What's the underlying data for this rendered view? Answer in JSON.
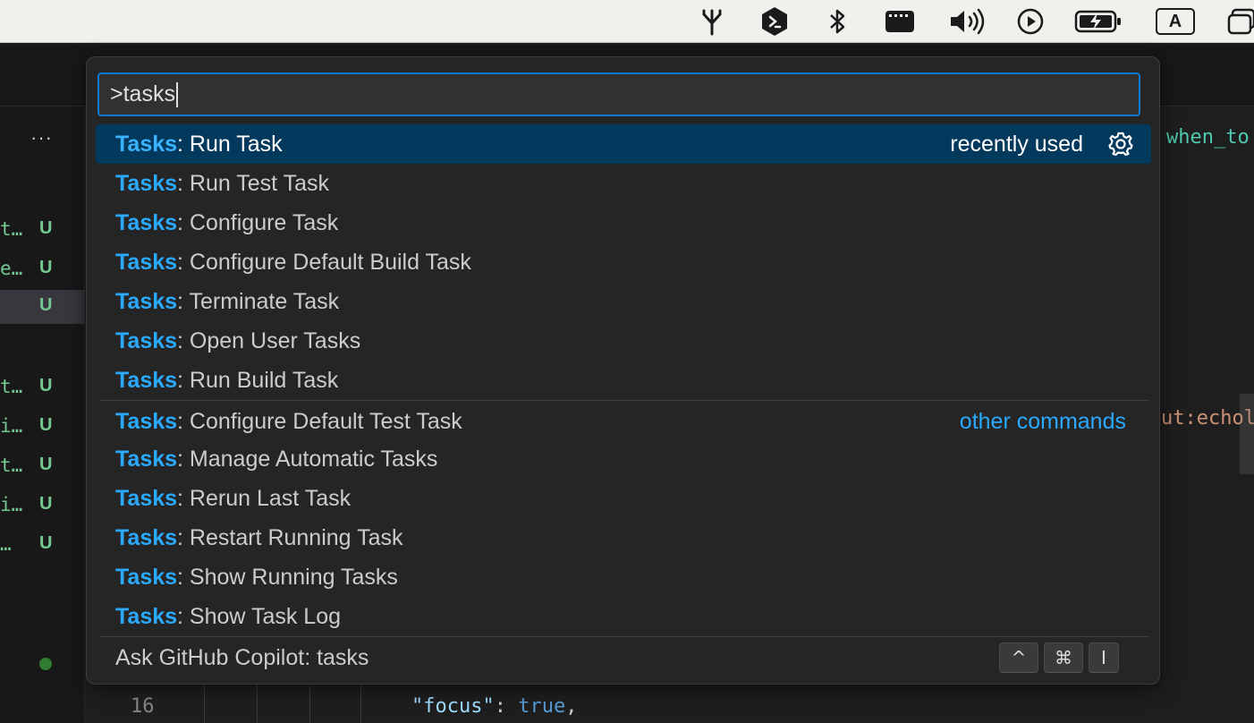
{
  "menubar": {
    "icons": [
      "fork-icon",
      "terminal-shield-icon",
      "bluetooth-icon",
      "display-icon",
      "volume-icon",
      "play-circle-icon",
      "battery-charging-icon",
      "input-source-icon",
      "screen-mirroring-icon"
    ],
    "input_source_letter": "A"
  },
  "sidebar": {
    "more_label": "···",
    "files": [
      {
        "name": "t…",
        "status": "U"
      },
      {
        "name": "e…",
        "status": "U"
      },
      {
        "name": "",
        "status": "U"
      },
      {
        "name": "t…",
        "status": "U"
      },
      {
        "name": "i…",
        "status": "U"
      },
      {
        "name": "t…",
        "status": "U"
      },
      {
        "name": "i…",
        "status": "U"
      },
      {
        "name": "…",
        "status": "U"
      }
    ]
  },
  "editor": {
    "line_number": "16",
    "code_key": "\"focus\"",
    "code_colon": ": ",
    "code_value": "true",
    "code_comma": ",",
    "edge_text_1": "when_to",
    "edge_text_2": "ut:echol"
  },
  "palette": {
    "input_value": ">tasks",
    "items": [
      {
        "prefix": "Tasks",
        "rest": ": Run Task",
        "right": "recently used"
      },
      {
        "prefix": "Tasks",
        "rest": ": Run Test Task"
      },
      {
        "prefix": "Tasks",
        "rest": ": Configure Task"
      },
      {
        "prefix": "Tasks",
        "rest": ": Configure Default Build Task"
      },
      {
        "prefix": "Tasks",
        "rest": ": Terminate Task"
      },
      {
        "prefix": "Tasks",
        "rest": ": Open User Tasks"
      },
      {
        "prefix": "Tasks",
        "rest": ": Run Build Task"
      },
      {
        "prefix": "Tasks",
        "rest": ": Configure Default Test Task",
        "right": "other commands"
      },
      {
        "prefix": "Tasks",
        "rest": ": Manage Automatic Tasks"
      },
      {
        "prefix": "Tasks",
        "rest": ": Rerun Last Task"
      },
      {
        "prefix": "Tasks",
        "rest": ": Restart Running Task"
      },
      {
        "prefix": "Tasks",
        "rest": ": Show Running Tasks"
      },
      {
        "prefix": "Tasks",
        "rest": ": Show Task Log"
      }
    ],
    "copilot_label": "Ask GitHub Copilot: tasks",
    "shortcut": [
      "^",
      "⌘",
      "I"
    ]
  },
  "colors": {
    "accent": "#0e7ad1",
    "highlight": "#2aaaff",
    "selected_bg": "#04395e",
    "untracked_green": "#73c991"
  }
}
